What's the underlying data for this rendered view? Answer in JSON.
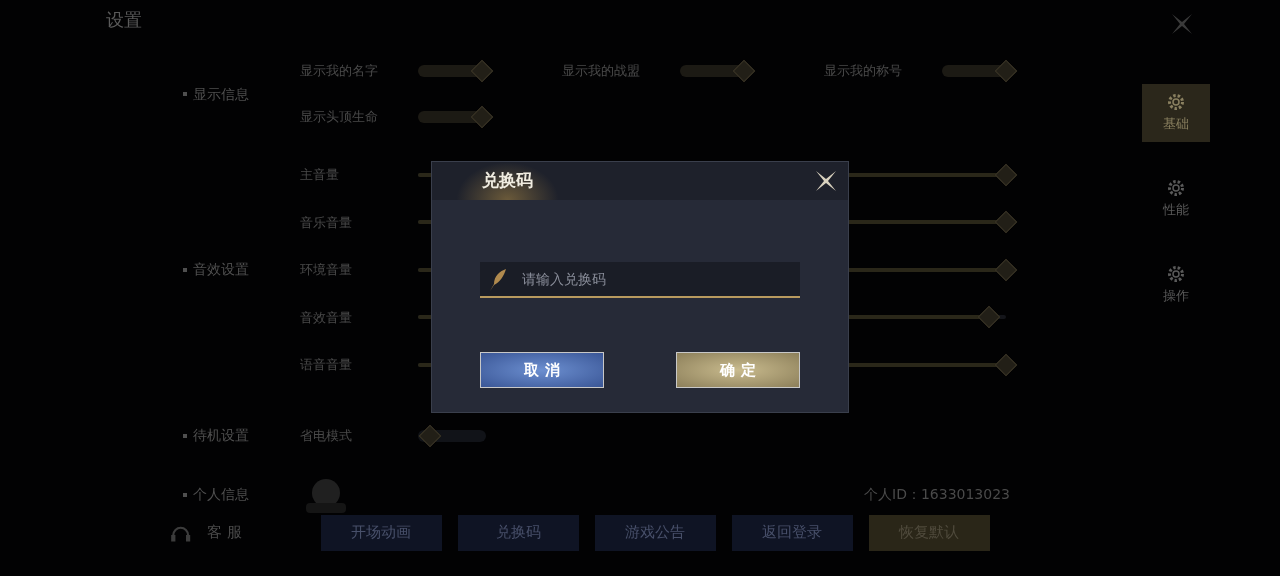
{
  "header": {
    "title": "设置"
  },
  "sections": [
    {
      "title": "显示信息",
      "kind": "toggle-grid",
      "items": [
        {
          "label": "显示我的名字",
          "on": true
        },
        {
          "label": "显示我的战盟",
          "on": true
        },
        {
          "label": "显示我的称号",
          "on": true
        },
        {
          "label": "显示头顶生命",
          "on": true
        }
      ]
    },
    {
      "title": "音效设置",
      "kind": "sliders",
      "items": [
        {
          "label": "主音量",
          "level": 1
        },
        {
          "label": "音乐音量",
          "level": 1
        },
        {
          "label": "环境音量",
          "level": 1
        },
        {
          "label": "音效音量",
          "level": 0.97
        },
        {
          "label": "语音音量",
          "level": 1
        }
      ]
    },
    {
      "title": "待机设置",
      "kind": "toggle-grid",
      "items": [
        {
          "label": "省电模式",
          "on": false
        }
      ]
    },
    {
      "title": "个人信息",
      "kind": "profile",
      "id_text": "个人ID：1633013023"
    }
  ],
  "side_tabs": [
    {
      "label": "基础",
      "selected": true
    },
    {
      "label": "性能",
      "selected": false
    },
    {
      "label": "操作",
      "selected": false
    }
  ],
  "bottom_bar": {
    "service": "客 服",
    "buttons": [
      {
        "label": "开场动画",
        "kind": "blue"
      },
      {
        "label": "兑换码",
        "kind": "blue"
      },
      {
        "label": "游戏公告",
        "kind": "blue"
      },
      {
        "label": "返回登录",
        "kind": "blue"
      },
      {
        "label": "恢复默认",
        "kind": "gold"
      }
    ]
  },
  "dialog": {
    "title": "兑换码",
    "input": {
      "placeholder": "请输入兑换码"
    },
    "buttons": [
      {
        "label": "取 消",
        "kind": "blue"
      },
      {
        "label": "确 定",
        "kind": "gold"
      }
    ]
  }
}
